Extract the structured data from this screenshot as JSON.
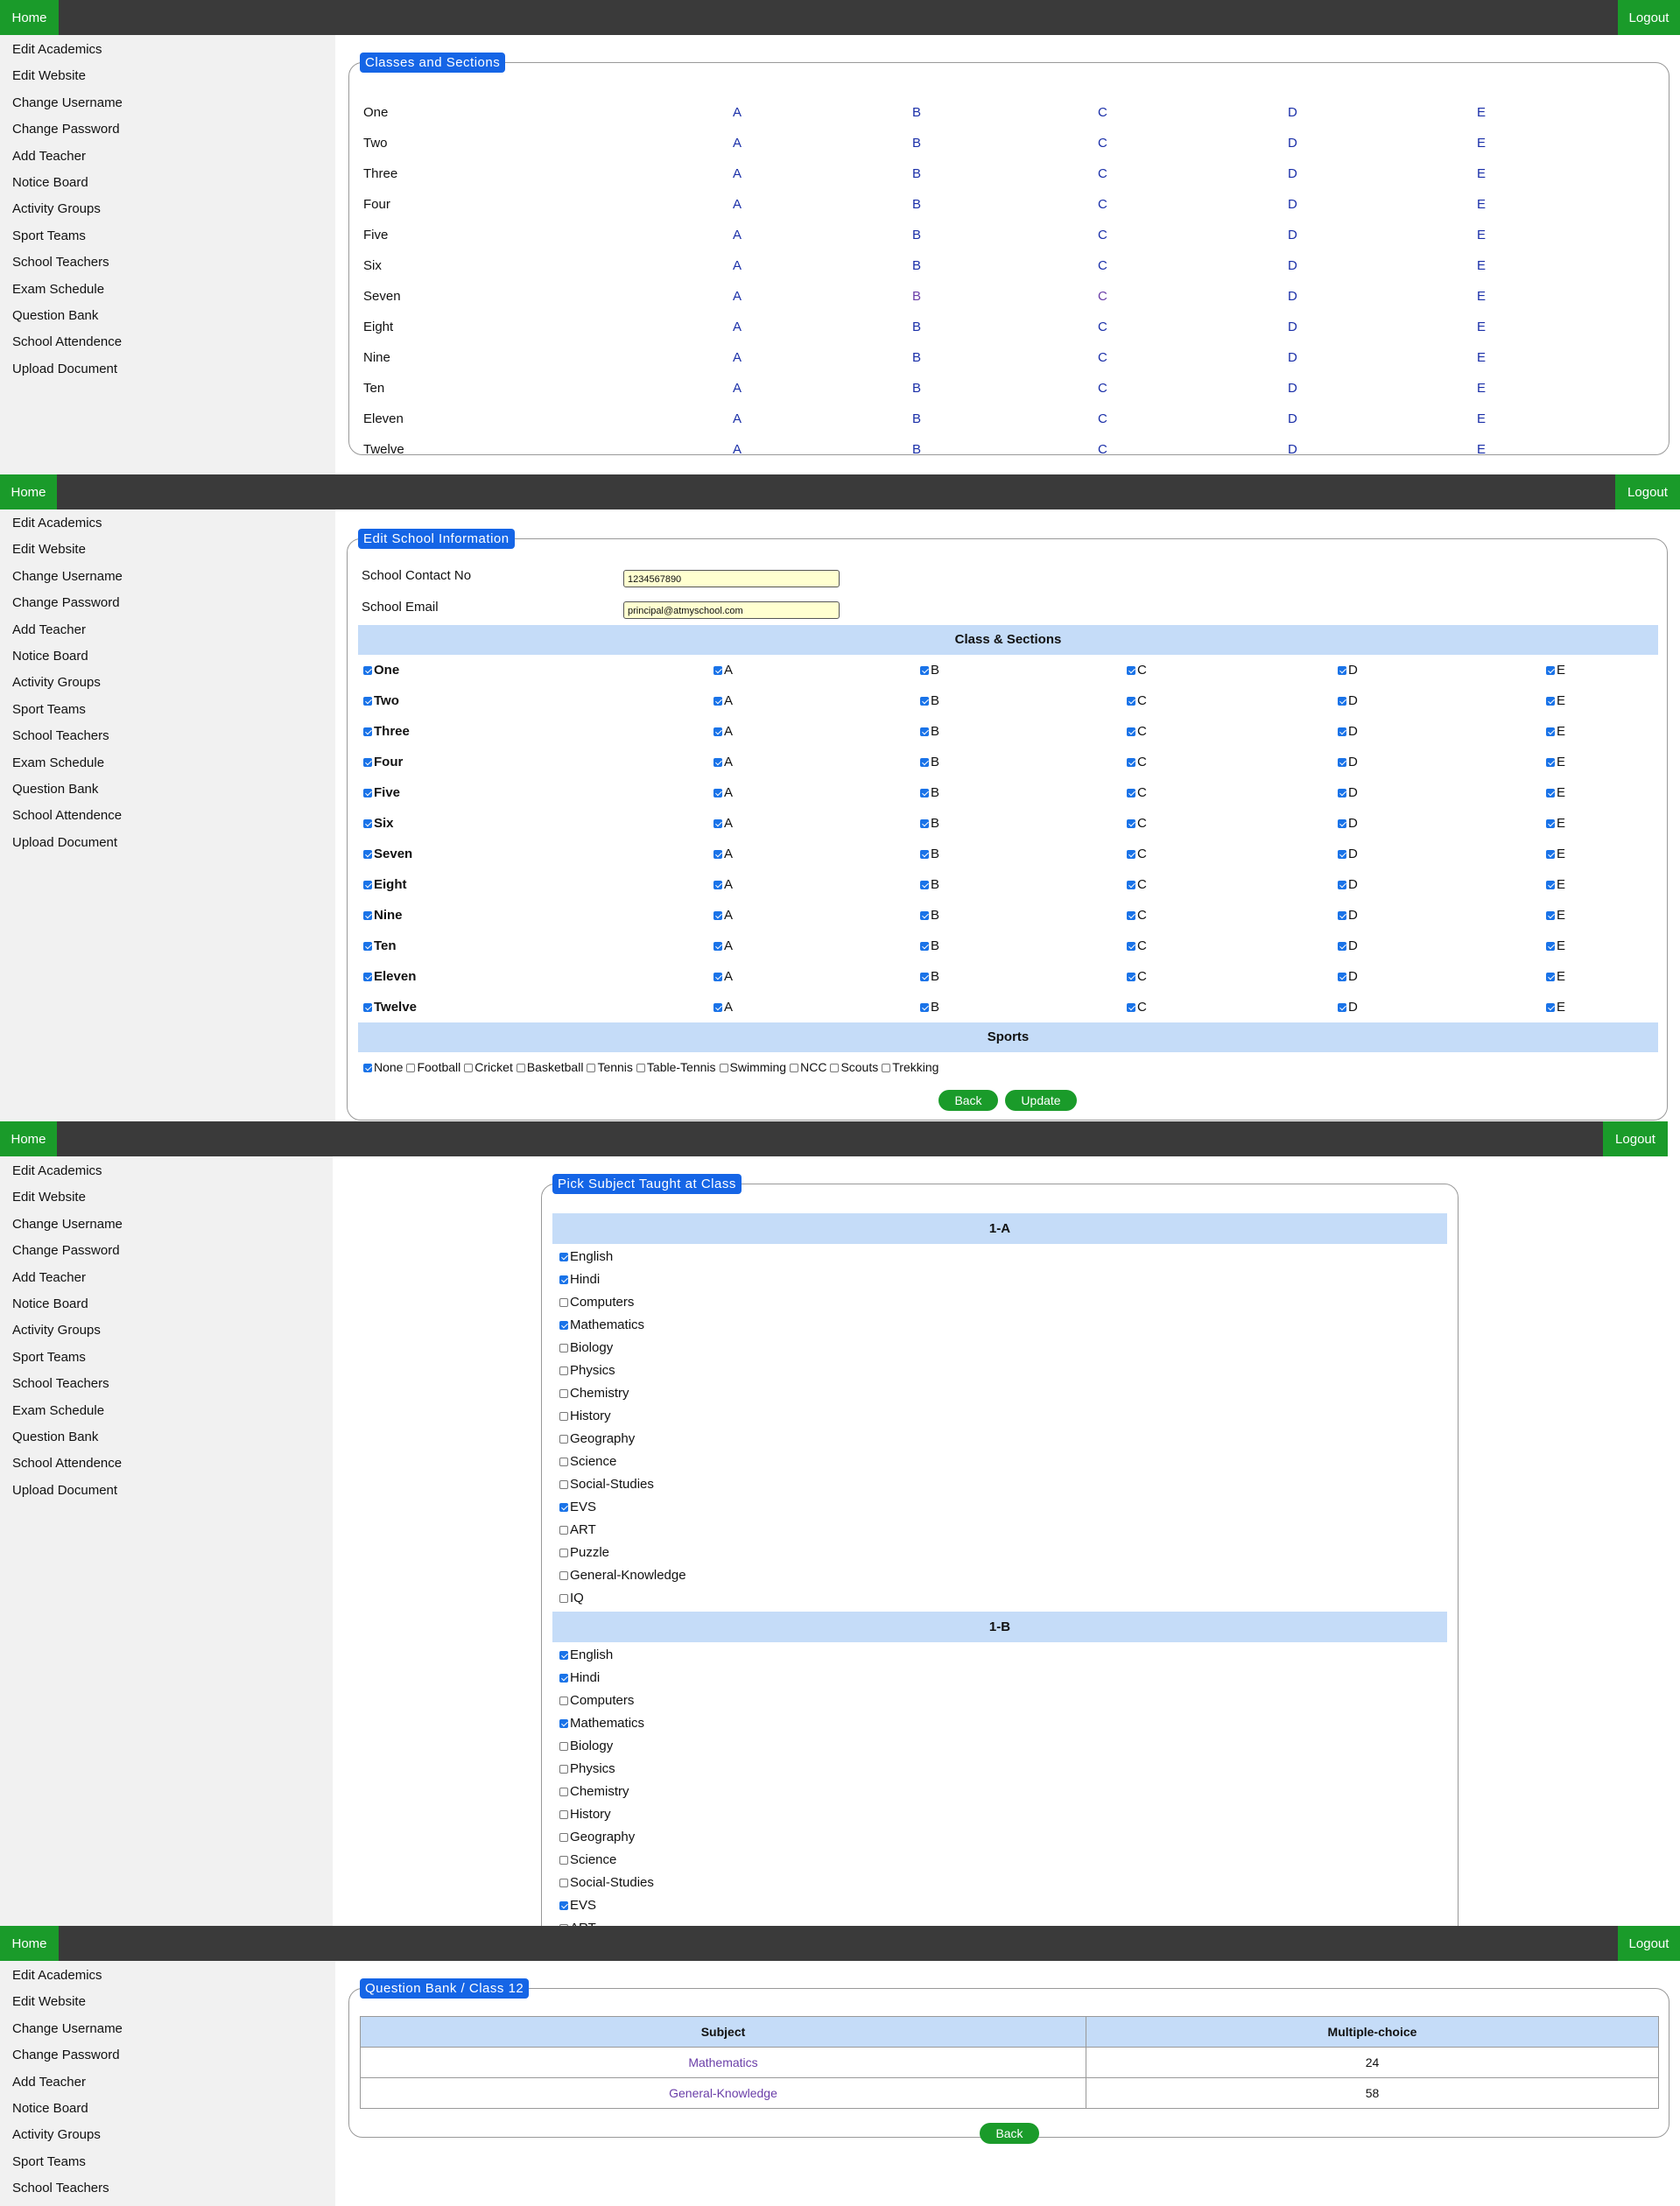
{
  "nav": {
    "home": "Home",
    "logout": "Logout"
  },
  "sidebar_items": [
    "Edit Academics",
    "Edit Website",
    "Change Username",
    "Change Password",
    "Add Teacher",
    "Notice Board",
    "Activity Groups",
    "Sport Teams",
    "School Teachers",
    "Exam Schedule",
    "Question Bank",
    "School Attendence",
    "Upload Document"
  ],
  "panel1": {
    "legend": "Classes and Sections",
    "classes": [
      "One",
      "Two",
      "Three",
      "Four",
      "Five",
      "Six",
      "Seven",
      "Eight",
      "Nine",
      "Ten",
      "Eleven",
      "Twelve"
    ],
    "sections": [
      "A",
      "B",
      "C",
      "D",
      "E"
    ]
  },
  "panel2": {
    "legend": "Edit School Information",
    "contact_label": "School Contact No",
    "contact_value": "1234567890",
    "email_label": "School Email",
    "email_value": "principal@atmyschool.com",
    "class_band": "Class & Sections",
    "classes": [
      "One",
      "Two",
      "Three",
      "Four",
      "Five",
      "Six",
      "Seven",
      "Eight",
      "Nine",
      "Ten",
      "Eleven",
      "Twelve"
    ],
    "sections": [
      "A",
      "B",
      "C",
      "D",
      "E"
    ],
    "sports_band": "Sports",
    "sports": [
      {
        "label": "None",
        "checked": true
      },
      {
        "label": "Football",
        "checked": false
      },
      {
        "label": "Cricket",
        "checked": false
      },
      {
        "label": "Basketball",
        "checked": false
      },
      {
        "label": "Tennis",
        "checked": false
      },
      {
        "label": "Table-Tennis",
        "checked": false
      },
      {
        "label": "Swimming",
        "checked": false
      },
      {
        "label": "NCC",
        "checked": false
      },
      {
        "label": "Scouts",
        "checked": false
      },
      {
        "label": "Trekking",
        "checked": false
      }
    ],
    "back": "Back",
    "update": "Update"
  },
  "panel3": {
    "legend": "Pick Subject Taught at Class",
    "groups": [
      {
        "title": "1-A",
        "subjects": [
          {
            "label": "English",
            "checked": true
          },
          {
            "label": "Hindi",
            "checked": true
          },
          {
            "label": "Computers",
            "checked": false
          },
          {
            "label": "Mathematics",
            "checked": true
          },
          {
            "label": "Biology",
            "checked": false
          },
          {
            "label": "Physics",
            "checked": false
          },
          {
            "label": "Chemistry",
            "checked": false
          },
          {
            "label": "History",
            "checked": false
          },
          {
            "label": "Geography",
            "checked": false
          },
          {
            "label": "Science",
            "checked": false
          },
          {
            "label": "Social-Studies",
            "checked": false
          },
          {
            "label": "EVS",
            "checked": true
          },
          {
            "label": "ART",
            "checked": false
          },
          {
            "label": "Puzzle",
            "checked": false
          },
          {
            "label": "General-Knowledge",
            "checked": false
          },
          {
            "label": "IQ",
            "checked": false
          }
        ]
      },
      {
        "title": "1-B",
        "subjects": [
          {
            "label": "English",
            "checked": true
          },
          {
            "label": "Hindi",
            "checked": true
          },
          {
            "label": "Computers",
            "checked": false
          },
          {
            "label": "Mathematics",
            "checked": true
          },
          {
            "label": "Biology",
            "checked": false
          },
          {
            "label": "Physics",
            "checked": false
          },
          {
            "label": "Chemistry",
            "checked": false
          },
          {
            "label": "History",
            "checked": false
          },
          {
            "label": "Geography",
            "checked": false
          },
          {
            "label": "Science",
            "checked": false
          },
          {
            "label": "Social-Studies",
            "checked": false
          },
          {
            "label": "EVS",
            "checked": true
          },
          {
            "label": "ART",
            "checked": false
          }
        ]
      }
    ]
  },
  "panel4": {
    "legend": "Question Bank / Class 12",
    "headers": [
      "Subject",
      "Multiple-choice"
    ],
    "rows": [
      {
        "subject": "Mathematics",
        "count": "24"
      },
      {
        "subject": "General-Knowledge",
        "count": "58"
      }
    ],
    "back": "Back"
  }
}
